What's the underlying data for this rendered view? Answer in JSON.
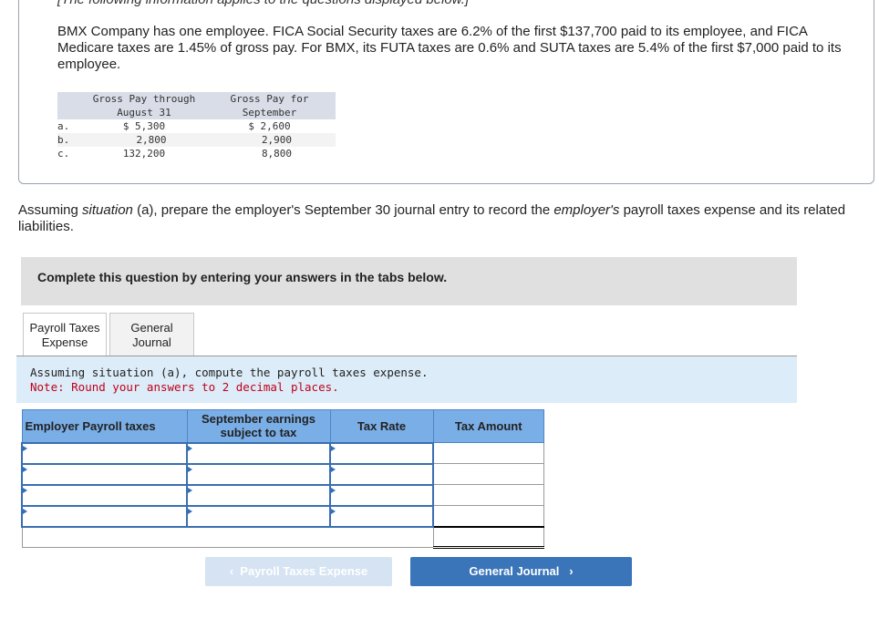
{
  "info": {
    "cut_text": "[The following information applies to the questions displayed below.]",
    "intro": "BMX Company has one employee. FICA Social Security taxes are 6.2% of the first $137,700 paid to its employee, and FICA Medicare taxes are 1.45% of gross pay. For BMX, its FUTA taxes are 0.6% and SUTA taxes are 5.4% of the first $7,000 paid to its employee.",
    "table": {
      "headers": [
        "",
        "Gross Pay through August 31",
        "Gross Pay for September"
      ],
      "rows": [
        [
          "a.",
          "$ 5,300",
          "$ 2,600"
        ],
        [
          "b.",
          "2,800",
          "2,900"
        ],
        [
          "c.",
          "132,200",
          "8,800"
        ]
      ]
    }
  },
  "question": {
    "p1": "Assuming ",
    "i1": "situation",
    "p2": " (a), prepare the employer's September 30 journal entry to record the ",
    "i2": "employer's",
    "p3": " payroll taxes expense and its related liabilities."
  },
  "banner": "Complete this question by entering your answers in the tabs below.",
  "tabs": [
    {
      "label": "Payroll Taxes Expense",
      "active": true
    },
    {
      "label": "General Journal",
      "active": false
    }
  ],
  "instructions": {
    "text": "Assuming situation (a), compute the payroll taxes expense.",
    "note": "Note: Round your answers to 2 decimal places."
  },
  "worksheet": {
    "headers": [
      "Employer Payroll taxes",
      "September earnings subject to tax",
      "Tax Rate",
      "Tax Amount"
    ],
    "rows": 4
  },
  "nav": {
    "prev": "Payroll Taxes Expense",
    "next": "General Journal"
  },
  "colors": {
    "header_blue": "#7aaee6",
    "next_button": "#3a75ba",
    "note_red": "#c0001a"
  }
}
